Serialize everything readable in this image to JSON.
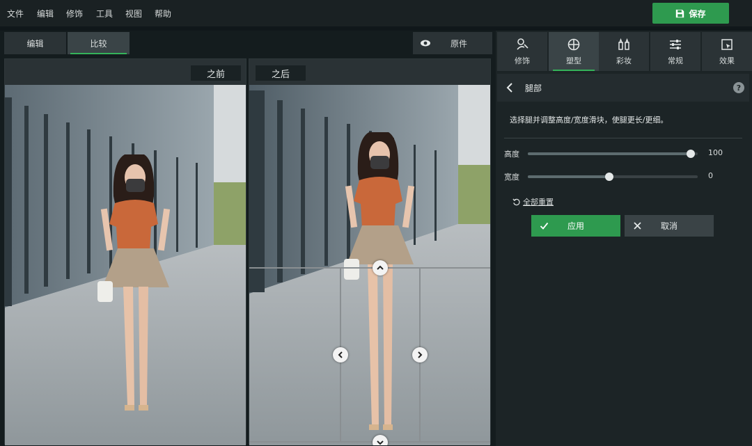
{
  "menu": {
    "items": [
      {
        "label": "文件"
      },
      {
        "label": "编辑"
      },
      {
        "label": "修饰"
      },
      {
        "label": "工具"
      },
      {
        "label": "视图"
      },
      {
        "label": "帮助"
      }
    ],
    "save_label": "保存"
  },
  "view_tabs": {
    "edit": "编辑",
    "compare": "比较",
    "original": "原件"
  },
  "compare": {
    "before": "之前",
    "after": "之后"
  },
  "tools": [
    {
      "label": "修饰",
      "icon": "retouch-icon"
    },
    {
      "label": "塑型",
      "icon": "reshape-icon"
    },
    {
      "label": "彩妆",
      "icon": "makeup-icon"
    },
    {
      "label": "常规",
      "icon": "sliders-icon"
    },
    {
      "label": "效果",
      "icon": "effects-icon"
    }
  ],
  "panel": {
    "title": "腿部",
    "description": "选择腿并调整高度/宽度滑块，使腿更长/更细。",
    "height_label": "高度",
    "height_value": "100",
    "height_level": 1.0,
    "width_label": "宽度",
    "width_value": "0",
    "width_level": 0.5,
    "reset_label": "全部重置",
    "apply_label": "应用",
    "cancel_label": "取消"
  },
  "colors": {
    "accent": "#35b35a",
    "button_green": "#2e9a4f"
  }
}
